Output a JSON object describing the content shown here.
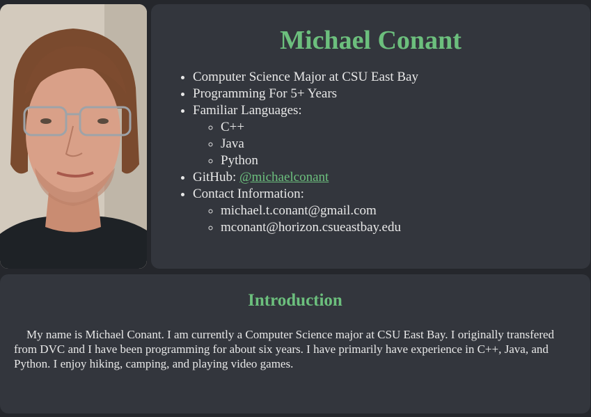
{
  "profile": {
    "name": "Michael Conant",
    "facts": {
      "major": "Computer Science Major at CSU East Bay",
      "experience": "Programming For 5+ Years",
      "languages_label": "Familiar Languages:",
      "languages": [
        "C++",
        "Java",
        "Python"
      ],
      "github_label": "GitHub:",
      "github_handle": "@michaelconant",
      "contact_label": "Contact Information:",
      "emails": [
        "michael.t.conant@gmail.com",
        "mconant@horizon.csueastbay.edu"
      ]
    }
  },
  "intro": {
    "heading": "Introduction",
    "body": "My name is Michael Conant. I am currently a Computer Science major at CSU East Bay. I originally transfered from DVC and I have been programming for about six years. I have primarily have experience in C++, Java, and Python. I enjoy hiking, camping, and playing video games."
  },
  "colors": {
    "background": "#25272c",
    "card": "#33363d",
    "accent": "#6cbf7d",
    "text": "#e8e8e8"
  },
  "icons": {
    "photo": "profile-photo"
  }
}
